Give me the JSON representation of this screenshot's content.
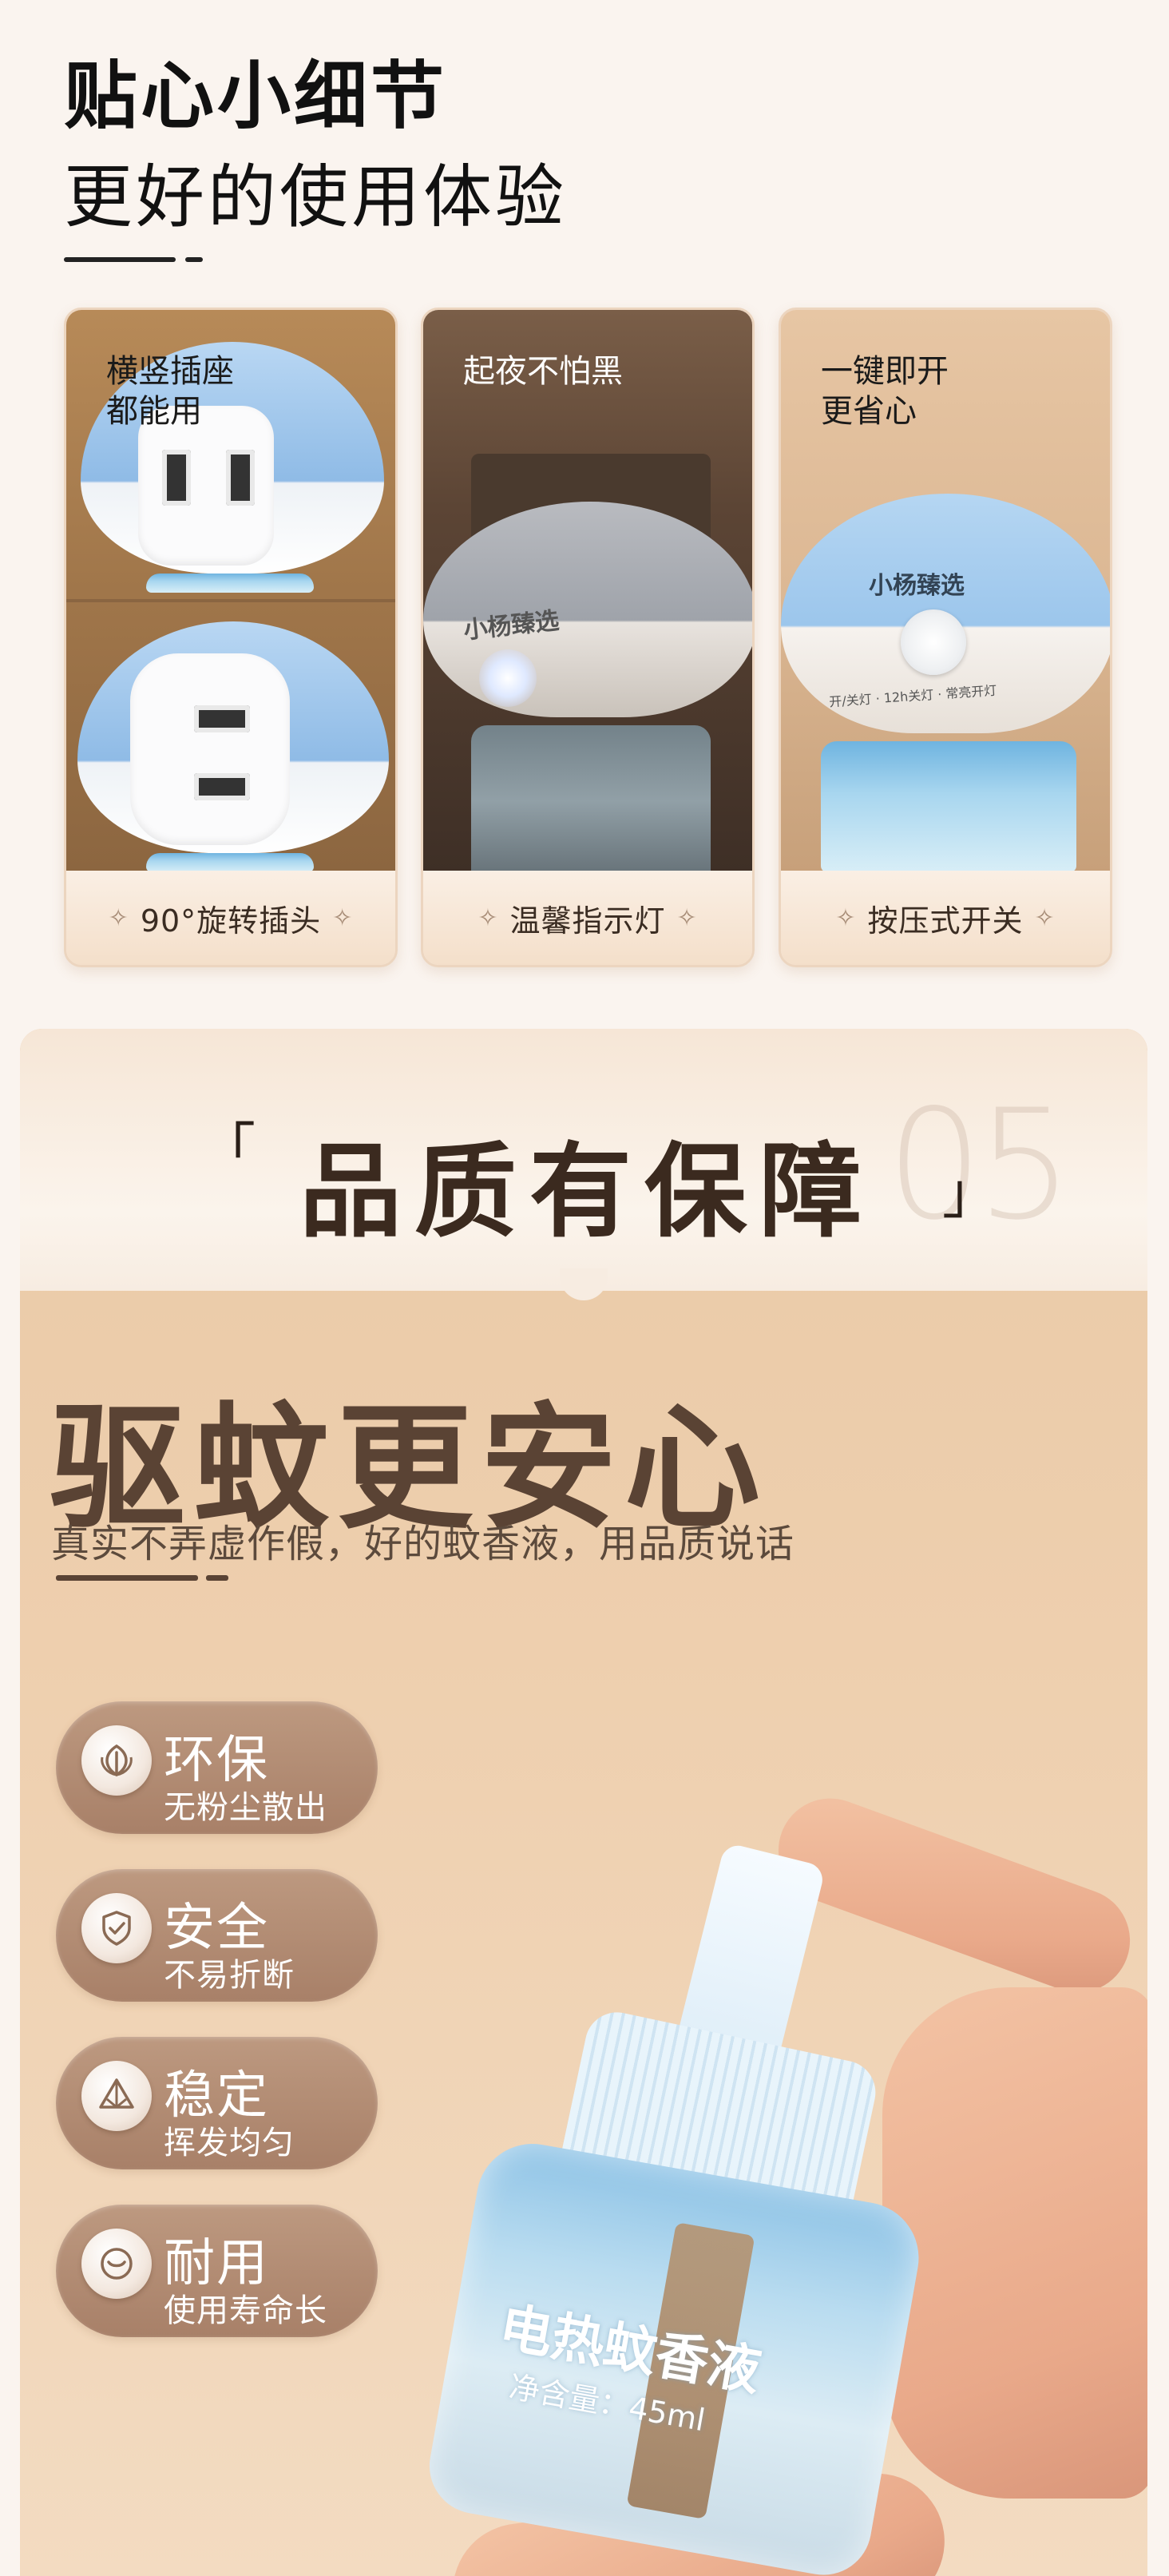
{
  "section_details": {
    "title": "贴心小细节",
    "subtitle": "更好的使用体验",
    "cards": [
      {
        "label_lines": [
          "横竖插座",
          "都能用"
        ],
        "caption": "90°旋转插头"
      },
      {
        "label_lines": [
          "起夜不怕黑"
        ],
        "caption": "温馨指示灯"
      },
      {
        "label_lines": [
          "一键即开",
          "更省心"
        ],
        "caption": "按压式开关"
      }
    ],
    "device_brand": "小杨臻选",
    "device_band_text": "开/关灯 · 12h关灯 · 常亮开灯"
  },
  "section_quality": {
    "bracket_open": "「",
    "banner_title": "品质有保障",
    "bracket_close": "」",
    "banner_number": "05",
    "headline": "驱蚊更安心",
    "description": "真实不弄虚作假，好的蚊香液，用品质说话",
    "product_label": "电热蚊香液",
    "product_volume": "净含量：45ml",
    "features": [
      {
        "icon": "leaf-icon",
        "title": "环保",
        "subtitle": "无粉尘散出"
      },
      {
        "icon": "shield-check-icon",
        "title": "安全",
        "subtitle": "不易折断"
      },
      {
        "icon": "pyramid-icon",
        "title": "稳定",
        "subtitle": "挥发均匀"
      },
      {
        "icon": "clock-icon",
        "title": "耐用",
        "subtitle": "使用寿命长"
      }
    ],
    "sparkle_glyph": "✧"
  },
  "colors": {
    "page_bg": "#faf4ef",
    "panel_bg": "#eecfae",
    "pill_bg": "#b38b72",
    "device_blue": "#9cc6ec",
    "title_brown": "#5a4334"
  }
}
